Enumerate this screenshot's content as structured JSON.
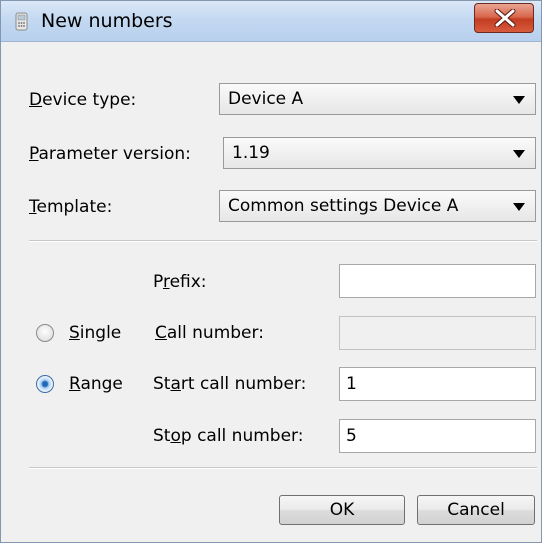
{
  "window": {
    "title": "New numbers",
    "icon": "phone-icon",
    "close_icon": "close-icon"
  },
  "form": {
    "device_type": {
      "label_u": "D",
      "label_rest": "evice type:",
      "value": "Device A"
    },
    "parameter_version": {
      "label_u": "P",
      "label_rest": "arameter version:",
      "value": "1.19"
    },
    "template": {
      "label_u": "T",
      "label_rest": "emplate:",
      "value": "Common settings Device A"
    },
    "prefix": {
      "label_pre": "P",
      "label_u": "r",
      "label_rest": "efix:",
      "value": ""
    },
    "call_number": {
      "label_u": "C",
      "label_rest": "all number:",
      "value": ""
    },
    "start_call_number": {
      "label_pre": "St",
      "label_u": "a",
      "label_rest": "rt call number:",
      "value": "1"
    },
    "stop_call_number": {
      "label_pre": "St",
      "label_u": "o",
      "label_rest": "p call number:",
      "value": "5"
    }
  },
  "mode": {
    "single": {
      "label_u": "S",
      "label_rest": "ingle",
      "selected": false
    },
    "range": {
      "label_u": "R",
      "label_rest": "ange",
      "selected": true
    }
  },
  "buttons": {
    "ok": "OK",
    "cancel": "Cancel"
  },
  "colors": {
    "titlebar": "#c4d9f1",
    "close_button": "#c43d22",
    "radio_selected": "#2f74c4",
    "window_bg": "#f0f0f0"
  }
}
